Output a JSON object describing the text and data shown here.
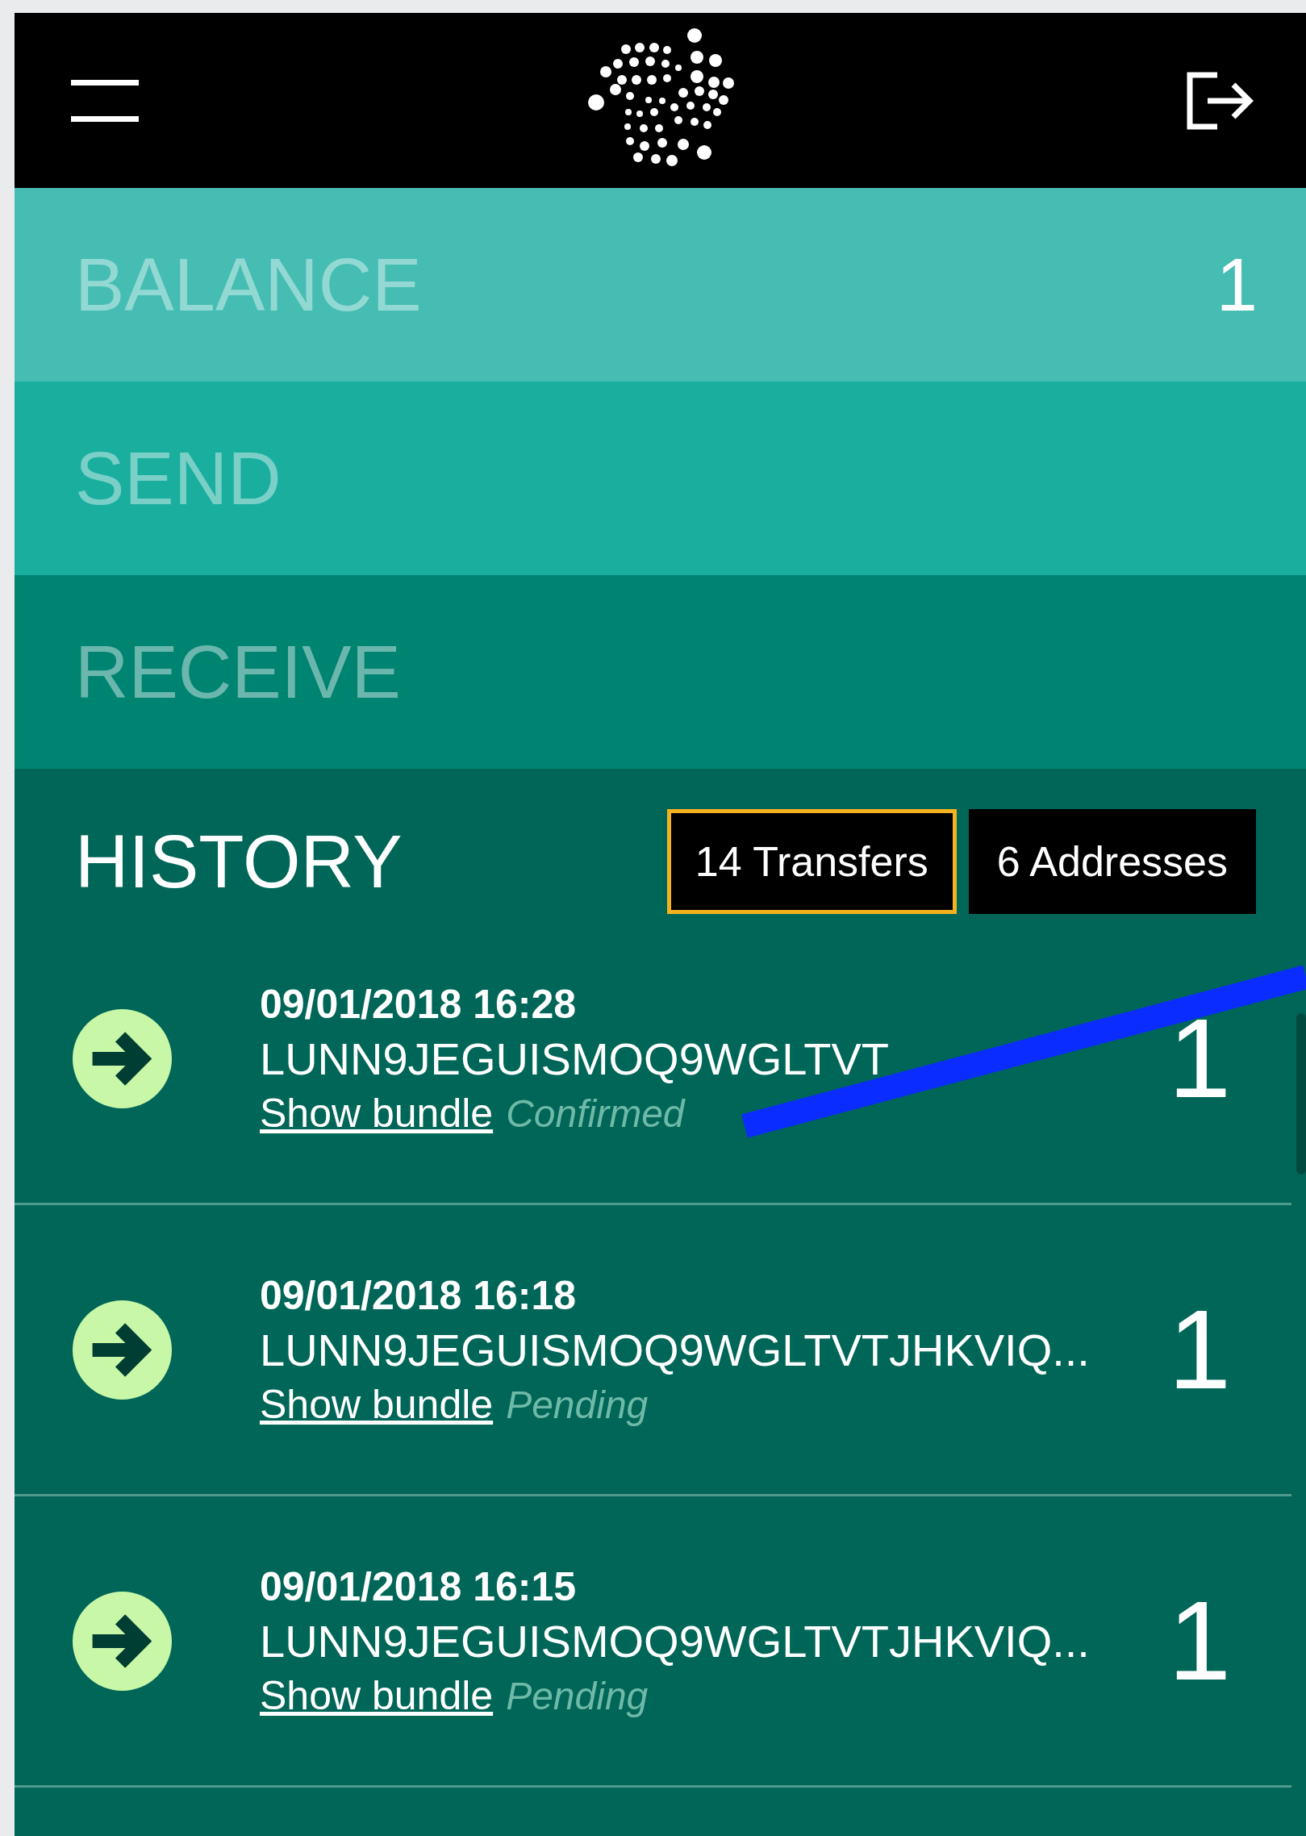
{
  "menu": [
    {
      "label": "BALANCE",
      "value": "1",
      "color": "#46bdb3"
    },
    {
      "label": "SEND",
      "color": "#1aae9f"
    },
    {
      "label": "RECEIVE",
      "color": "#008472"
    }
  ],
  "history": {
    "title": "HISTORY",
    "tabs": [
      {
        "label": "14 Transfers",
        "selected": true
      },
      {
        "label": "6 Addresses",
        "selected": false
      }
    ],
    "rows": [
      {
        "date": "09/01/2018 16:28",
        "address": "LUNN9JEGUISMOQ9WGLTVT",
        "link": "Show bundle",
        "status": "Confirmed",
        "amount": "1"
      },
      {
        "date": "09/01/2018 16:18",
        "address": "LUNN9JEGUISMOQ9WGLTVTJHKVIQ...",
        "link": "Show bundle",
        "status": "Pending",
        "amount": "1"
      },
      {
        "date": "09/01/2018 16:15",
        "address": "LUNN9JEGUISMOQ9WGLTVTJHKVIQ...",
        "link": "Show bundle",
        "status": "Pending",
        "amount": "1"
      }
    ]
  }
}
